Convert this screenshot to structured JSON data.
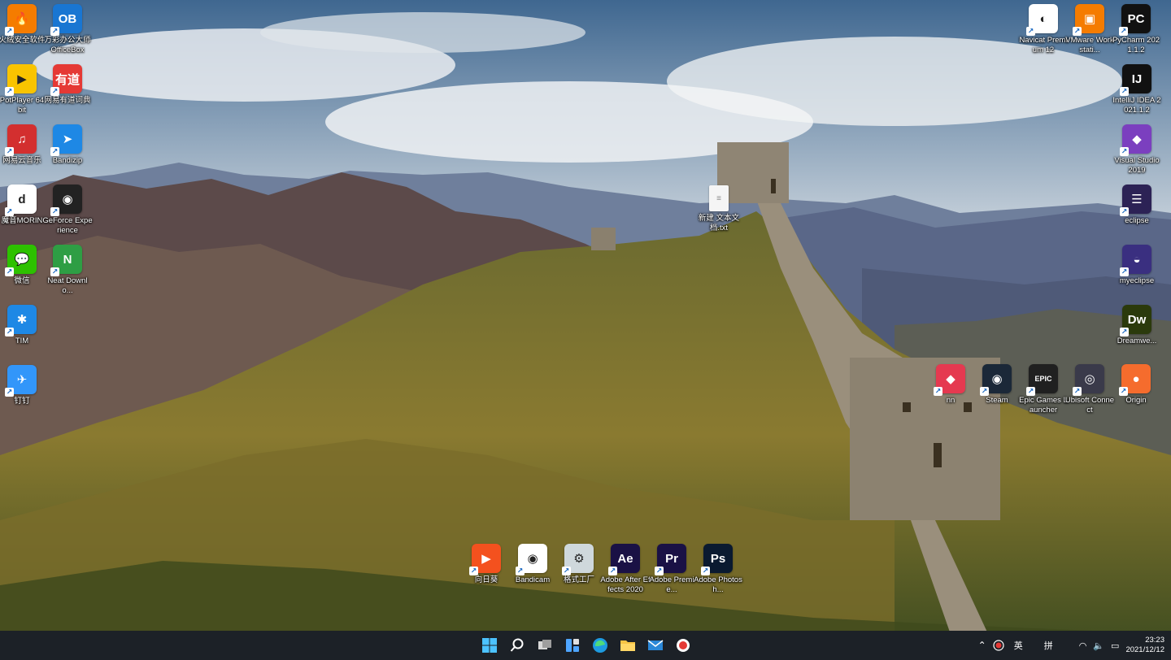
{
  "desktop": {
    "icons_left_col1": [
      {
        "label": "火绒安全软件",
        "icon": "huorong-icon",
        "color": "#f57c00",
        "glyph": "🔥"
      },
      {
        "label": "PotPlayer 64 bit",
        "icon": "potplayer-icon",
        "color": "#f9c400",
        "glyph": "▶"
      },
      {
        "label": "网易云音乐",
        "icon": "netease-music-icon",
        "color": "#d32f2f",
        "glyph": "♫"
      },
      {
        "label": "魔音MORIN",
        "icon": "morin-icon",
        "color": "#ffffff",
        "glyph": "d"
      },
      {
        "label": "微信",
        "icon": "wechat-icon",
        "color": "#2dc100",
        "glyph": "💬"
      },
      {
        "label": "TIM",
        "icon": "tim-icon",
        "color": "#1e88e5",
        "glyph": "✱"
      },
      {
        "label": "钉钉",
        "icon": "dingtalk-icon",
        "color": "#3296fa",
        "glyph": "✈"
      }
    ],
    "icons_left_col2": [
      {
        "label": "万彩办公大师 OfficeBox",
        "icon": "officebox-icon",
        "color": "#1976d2",
        "glyph": "OB"
      },
      {
        "label": "网易有道词典",
        "icon": "youdao-icon",
        "color": "#e53935",
        "glyph": "有道"
      },
      {
        "label": "Bandizip",
        "icon": "bandizip-icon",
        "color": "#1e88e5",
        "glyph": "➤"
      },
      {
        "label": "GeForce Experience",
        "icon": "geforce-icon",
        "color": "#222222",
        "glyph": "◉"
      },
      {
        "label": "Neat Downlo...",
        "icon": "neat-download-icon",
        "color": "#2e9e44",
        "glyph": "N"
      }
    ],
    "icons_right_top": [
      {
        "label": "Navicat Premium 12",
        "icon": "navicat-icon",
        "color": "#ffffff",
        "glyph": "◐"
      },
      {
        "label": "VMware Workstati...",
        "icon": "vmware-icon",
        "color": "#f57c00",
        "glyph": "▣"
      },
      {
        "label": "PyCharm 2021.1.2",
        "icon": "pycharm-icon",
        "color": "#111111",
        "glyph": "PC"
      }
    ],
    "icons_right_col": [
      {
        "label": "IntelliJ IDEA 2021.1.2",
        "icon": "intellij-icon",
        "color": "#111111",
        "glyph": "IJ"
      },
      {
        "label": "Visual Studio 2019",
        "icon": "visual-studio-icon",
        "color": "#7b3fbf",
        "glyph": "◆"
      },
      {
        "label": "eclipse",
        "icon": "eclipse-icon",
        "color": "#2c2255",
        "glyph": "☰"
      },
      {
        "label": "myeclipse",
        "icon": "myeclipse-icon",
        "color": "#3a2f80",
        "glyph": "◒"
      },
      {
        "label": "Dreamwe...",
        "icon": "dreamweaver-icon",
        "color": "#2b3a0c",
        "glyph": "Dw"
      }
    ],
    "icons_right_row": [
      {
        "label": "nn",
        "icon": "nn-icon",
        "color": "#e53950",
        "glyph": "◆"
      },
      {
        "label": "Steam",
        "icon": "steam-icon",
        "color": "#1b2838",
        "glyph": "◉"
      },
      {
        "label": "Epic Games Launcher",
        "icon": "epic-games-icon",
        "color": "#202020",
        "glyph": "EPIC"
      },
      {
        "label": "Ubisoft Connect",
        "icon": "ubisoft-icon",
        "color": "#3a3a4a",
        "glyph": "◎"
      },
      {
        "label": "Origin",
        "icon": "origin-icon",
        "color": "#f56c2d",
        "glyph": "●"
      }
    ],
    "icons_bottom_row": [
      {
        "label": "向日葵",
        "icon": "sunlogin-icon",
        "color": "#f4511e",
        "glyph": "▶"
      },
      {
        "label": "Bandicam",
        "icon": "bandicam-icon",
        "color": "#ffffff",
        "glyph": "◉"
      },
      {
        "label": "格式工厂",
        "icon": "format-factory-icon",
        "color": "#cfd8dc",
        "glyph": "⚙"
      },
      {
        "label": "Adobe After Effects 2020",
        "icon": "after-effects-icon",
        "color": "#1a1145",
        "glyph": "Ae"
      },
      {
        "label": "Adobe Premie...",
        "icon": "premiere-icon",
        "color": "#1a1145",
        "glyph": "Pr"
      },
      {
        "label": "Adobe Photosh...",
        "icon": "photoshop-icon",
        "color": "#0a1a30",
        "glyph": "Ps"
      }
    ],
    "text_file": {
      "label": "新建 文本文 档.txt",
      "icon": "text-file-icon"
    }
  },
  "taskbar": {
    "apps": [
      {
        "name": "start-button",
        "icon": "windows-logo-icon"
      },
      {
        "name": "search-button",
        "icon": "search-icon"
      },
      {
        "name": "task-view-button",
        "icon": "task-view-icon"
      },
      {
        "name": "widgets-button",
        "icon": "widgets-icon"
      },
      {
        "name": "edge-button",
        "icon": "edge-icon"
      },
      {
        "name": "file-explorer-button",
        "icon": "folder-icon"
      },
      {
        "name": "mail-button",
        "icon": "mail-icon"
      },
      {
        "name": "bandicam-taskbar-button",
        "icon": "record-icon"
      }
    ],
    "tray": {
      "ime_lang": "英",
      "ime_mode": "拼",
      "time": "23:23",
      "date": "2021/12/12"
    }
  }
}
